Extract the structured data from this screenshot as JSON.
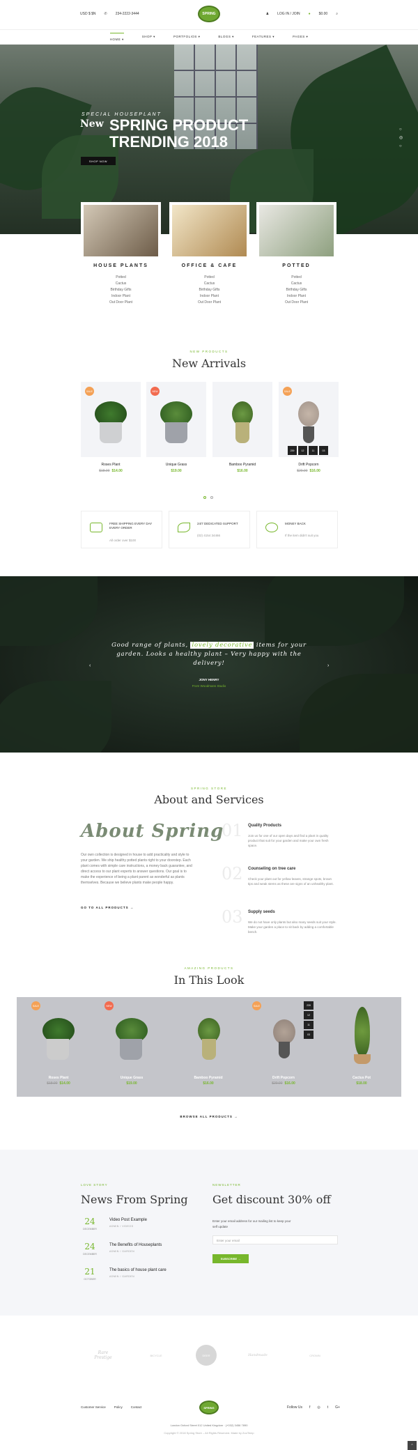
{
  "header": {
    "left_text": "USD $ $N",
    "phone": "234-2222-3444",
    "account": "LOG IN / JOIN",
    "cart": "$0.00",
    "logo": "SPRING"
  },
  "nav": [
    "HOME ▾",
    "SHOP ▾",
    "PORTFOLIOS ▾",
    "BLOGS ▾",
    "FEATURES ▾",
    "PAGES ▾"
  ],
  "hero": {
    "subtitle": "SPECIAL HOUSEPLANT",
    "new": "New",
    "title": "SPRING PRODUCT TRENDING 2018",
    "button": "SHOP NOW",
    "dots": [
      "○",
      "◎",
      "○"
    ]
  },
  "categories": [
    {
      "title": "HOUSE PLANTS",
      "items": [
        "Potted",
        "Cactus",
        "Birthday Gifts",
        "Indoor Plant",
        "Out Door Plant"
      ]
    },
    {
      "title": "OFFICE & CAFE",
      "items": [
        "Potted",
        "Cactus",
        "Birthday Gifts",
        "Indoor Plant",
        "Out Door Plant"
      ]
    },
    {
      "title": "POTTED",
      "items": [
        "Potted",
        "Cactus",
        "Birthday Gifts",
        "Indoor Plant",
        "Out Door Plant"
      ]
    }
  ],
  "arrivals": {
    "kicker": "NEW PRODUCTS",
    "title": "New Arrivals",
    "products": [
      {
        "badge": "SALE",
        "name": "Roses Plant",
        "old": "$18.00",
        "price": "$14.00"
      },
      {
        "badge": "NEW",
        "name": "Unique Grass",
        "old": "",
        "price": "$19.00"
      },
      {
        "badge": "",
        "name": "Bamboo Pyramid",
        "old": "",
        "price": "$16.00"
      },
      {
        "badge": "SALE",
        "name": "Drift Popcorn",
        "old": "$20.00",
        "price": "$16.00"
      }
    ],
    "countdown": [
      {
        "v": "239",
        "l": "Days"
      },
      {
        "v": "12",
        "l": "Hours"
      },
      {
        "v": "11",
        "l": "Mins"
      },
      {
        "v": "03",
        "l": "Secs"
      }
    ]
  },
  "features": [
    {
      "title": "FREE SHIPPING EVERY DAY EVERY ORDER",
      "sub": "All order over $100"
    },
    {
      "title": "24/7 DEDICATED SUPPORT",
      "sub": "(02) 4154 34466"
    },
    {
      "title": "MONEY BACK",
      "sub": "If the item didn't suit you"
    }
  ],
  "testimonial": {
    "before": "Good range of plants, ",
    "highlight": "lovely decorative",
    "after": " items for your garden. Looks a healthy plant – Very happy with the delivery!",
    "name": "JONY HENRY",
    "source": "From Woodmans Studio"
  },
  "about": {
    "kicker": "SPRING STORE",
    "title": "About and Services",
    "big": "About Spring",
    "text": "Our own collection is designed in house to add practicality and style to your garden. We ship healthy potted plants right to your doorstep. Each plant comes with simple care instructions, a money back guarantee, and direct access to our plant experts to answer questions. Our goal is to make the experience of being a plant parent as wonderful as plants themselves. Because we believe plants make people happy.",
    "link": "GO TO ALL PRODUCTS →",
    "services": [
      {
        "num": "01",
        "title": "Quality Products",
        "desc": "Join us for one of our open days and find a plant in quality product that suit for your garden and make your own fresh space."
      },
      {
        "num": "02",
        "title": "Counseling on tree care",
        "desc": "Check your plant out for yellow leaves, strange spots, brown tips and weak stems as these are signs of an unhealthy plant."
      },
      {
        "num": "03",
        "title": "Supply seeds",
        "desc": "We do not have only plants but also many seeds suit your style. Make your garden a place to sit back by adding a comfortable bench."
      }
    ]
  },
  "look": {
    "kicker": "AMAZING PRODUCTS",
    "title": "In This Look",
    "items": [
      {
        "badge": "SALE",
        "name": "Roses Plant",
        "old": "$18.00",
        "price": "$14.00"
      },
      {
        "badge": "NEW",
        "name": "Unique Grass",
        "old": "",
        "price": "$19.00"
      },
      {
        "badge": "",
        "name": "Bamboo Pyramid",
        "old": "",
        "price": "$16.00"
      },
      {
        "badge": "SALE",
        "name": "Drift Popcorn",
        "old": "$20.00",
        "price": "$16.00"
      },
      {
        "badge": "",
        "name": "Cactus Pot",
        "old": "",
        "price": "$18.00"
      }
    ],
    "countdown": [
      "239",
      "12",
      "11",
      "03"
    ],
    "browse": "BROWSE ALL PRODUCTS →"
  },
  "news": {
    "kicker": "LOVE STORY",
    "title": "News From Spring",
    "posts": [
      {
        "day": "24",
        "month": "DECEMBER",
        "title": "Video Post Example",
        "cat": "ADMIN / VIDEOS"
      },
      {
        "day": "24",
        "month": "DECEMBER",
        "title": "The Benefits of Houseplants",
        "cat": "ADMIN / GARDEN"
      },
      {
        "day": "21",
        "month": "OCTOBER",
        "title": "The basics of house plant care",
        "cat": "ADMIN / GARDEN"
      }
    ]
  },
  "newsletter": {
    "kicker": "NEWSLETTER",
    "title": "Get discount 30% off",
    "text": "Enter your email address for our mailing list to keep your self update",
    "placeholder": "Enter your email",
    "button": "SUBSCRIBE →"
  },
  "brands": [
    "Rare Prestige",
    "BICYCLE",
    "DEER",
    "Handmade",
    "CROWN"
  ],
  "footer": {
    "links": [
      "Customer Service",
      "Policy",
      "Contact"
    ],
    "follow": "Follow Us",
    "social": [
      "f",
      "◎",
      "t",
      "G+"
    ],
    "address": "London Oxford Street 012 United Kingdom  ·  (+032) 3456 7890",
    "copy": "Copyright © 2018 Spring Store – All Rights Reserved. Made by ZooTemp",
    "top": "⌃"
  }
}
